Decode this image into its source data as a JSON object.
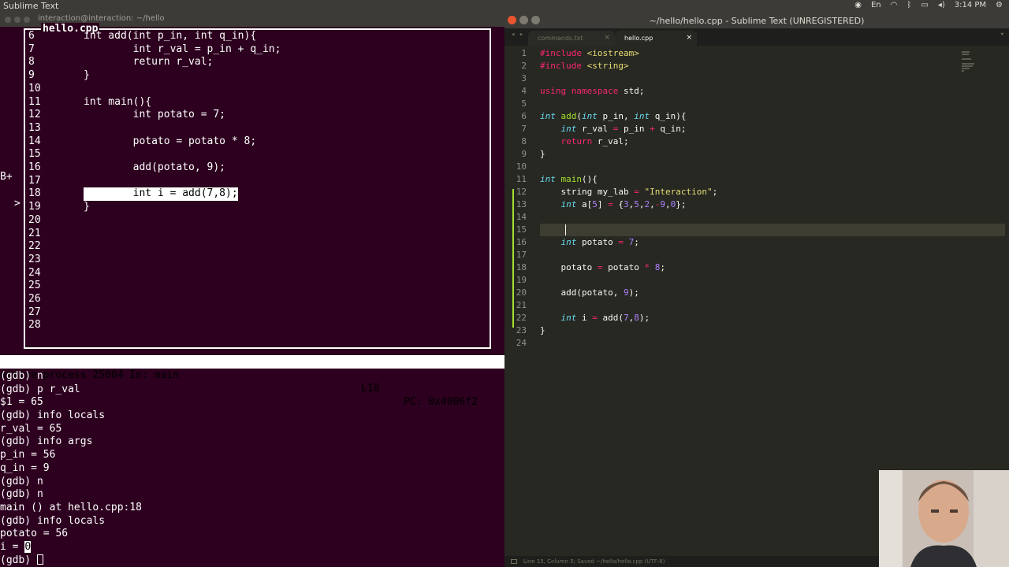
{
  "system": {
    "app_title": "Sublime Text",
    "time": "3:14 PM",
    "lang": "En"
  },
  "terminal": {
    "title": "interaction@interaction: ~/hello",
    "src_title": "hello.cpp",
    "lines": [
      {
        "num": "6",
        "text": "int add(int p_in, int q_in){"
      },
      {
        "num": "7",
        "text": "        int r_val = p_in + q_in;"
      },
      {
        "num": "8",
        "text": "        return r_val;"
      },
      {
        "num": "9",
        "text": "}"
      },
      {
        "num": "10",
        "text": ""
      },
      {
        "num": "11",
        "text": "int main(){"
      },
      {
        "num": "12",
        "text": "        int potato = 7;"
      },
      {
        "num": "13",
        "text": ""
      },
      {
        "num": "14",
        "text": "        potato = potato * 8;"
      },
      {
        "num": "15",
        "text": ""
      },
      {
        "num": "16",
        "text": "        add(potato, 9);"
      },
      {
        "num": "17",
        "text": ""
      },
      {
        "num": "18",
        "text": "        int i = add(7,8);"
      },
      {
        "num": "19",
        "text": "}"
      },
      {
        "num": "20",
        "text": ""
      },
      {
        "num": "21",
        "text": ""
      },
      {
        "num": "22",
        "text": ""
      },
      {
        "num": "23",
        "text": ""
      },
      {
        "num": "24",
        "text": ""
      },
      {
        "num": "25",
        "text": ""
      },
      {
        "num": "26",
        "text": ""
      },
      {
        "num": "27",
        "text": ""
      },
      {
        "num": "28",
        "text": ""
      }
    ],
    "breakpoint_marker": "B+",
    "current_marker": ">",
    "status_left": "native process 25004 In: main",
    "status_line": "L18",
    "status_pc": "PC: 0x4006f2",
    "gdb_lines": [
      "(gdb) n",
      "(gdb) p r_val",
      "$1 = 65",
      "(gdb) info locals",
      "r_val = 65",
      "(gdb) info args",
      "p_in = 56",
      "q_in = 9",
      "(gdb) n",
      "(gdb) n",
      "main () at hello.cpp:18",
      "(gdb) info locals",
      "potato = 56"
    ],
    "gdb_i_prefix": "i = ",
    "gdb_i_value": "0",
    "gdb_prompt": "(gdb) "
  },
  "sublime": {
    "title": "~/hello/hello.cpp - Sublime Text (UNREGISTERED)",
    "tabs": [
      {
        "label": "commands.txt"
      },
      {
        "label": "hello.cpp"
      }
    ],
    "tab_close": "×",
    "status": "Line 15, Column 5; Saved ~/hello/hello.cpp (UTF-8)",
    "line_numbers": [
      "1",
      "2",
      "3",
      "4",
      "5",
      "6",
      "7",
      "8",
      "9",
      "10",
      "11",
      "12",
      "13",
      "14",
      "15",
      "16",
      "17",
      "18",
      "19",
      "20",
      "21",
      "22",
      "23",
      "24"
    ]
  },
  "colors": {
    "terminal_bg": "#2c001e",
    "editor_bg": "#272822",
    "keyword": "#f92672",
    "type": "#66d9ef",
    "string": "#e6db74",
    "number": "#ae81ff"
  }
}
